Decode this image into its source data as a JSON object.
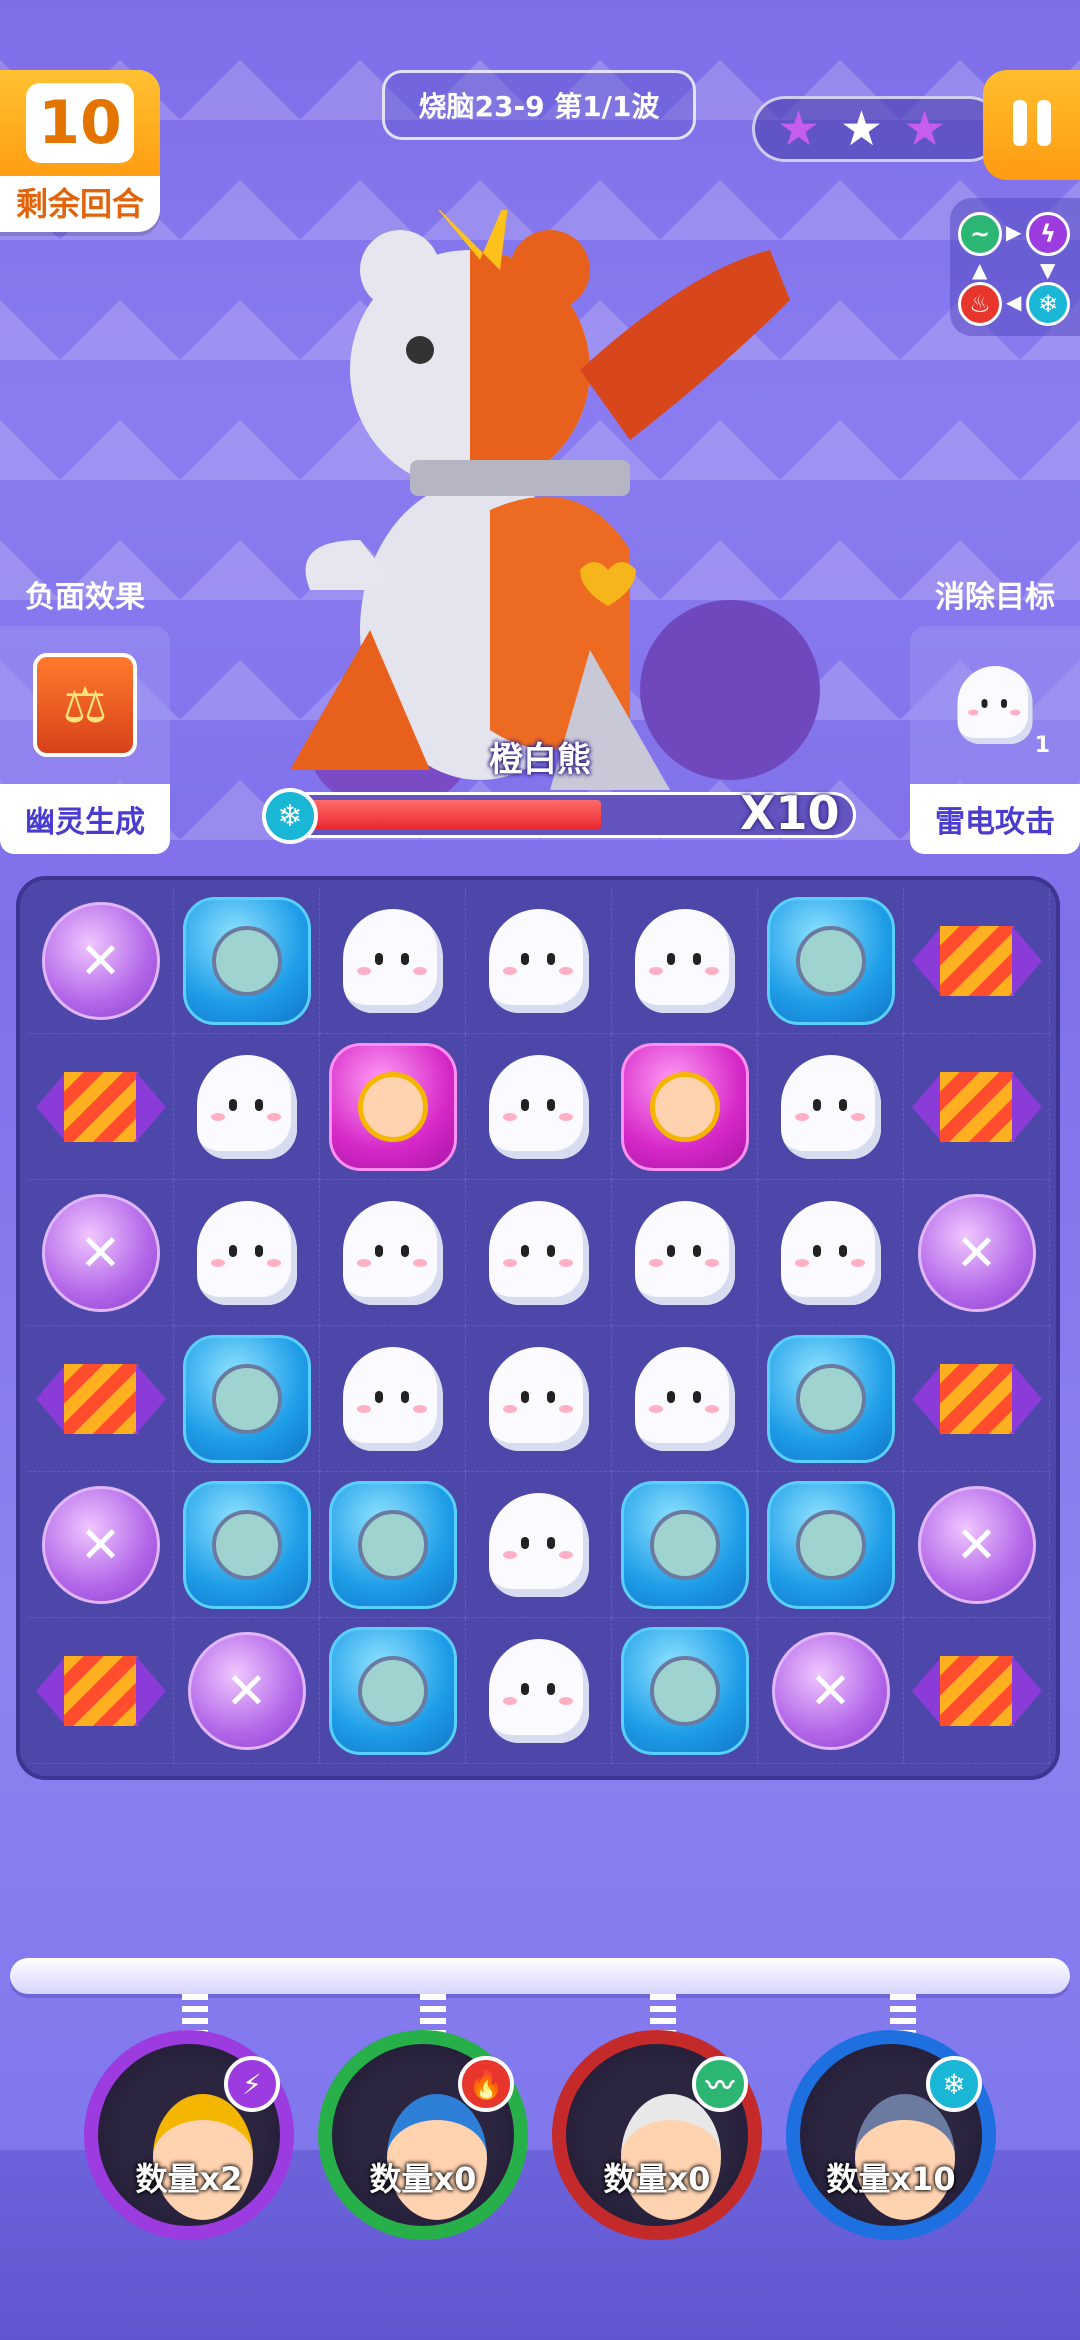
{
  "hud": {
    "turns_value": "10",
    "turns_label": "剩余回合",
    "level_text": "烧脑23-9 第1/1波",
    "stars": [
      "★",
      "★",
      "★"
    ],
    "star_colors": [
      "#c65cf0",
      "#ffffff",
      "#c65cf0"
    ],
    "pause_icon": "pause-icon"
  },
  "element_cycle": {
    "nodes": [
      "wind",
      "lightning",
      "fire",
      "ice"
    ],
    "colors": {
      "wind": "#2bb673",
      "lightning": "#9c3be0",
      "fire": "#e8362d",
      "ice": "#19b6d6"
    }
  },
  "left_panel": {
    "title": "负面效果",
    "icon": "scale-debuff-icon",
    "footer": "幽灵生成"
  },
  "right_panel": {
    "title": "消除目标",
    "target_icon": "ghost-icon",
    "target_count": "1",
    "footer": "雷电攻击"
  },
  "boss": {
    "name": "橙白熊",
    "hp_multiplier": "X10",
    "hp_fraction": 0.55
  },
  "board": {
    "rows": [
      [
        "orb",
        "blue",
        "ghost",
        "ghost",
        "ghost",
        "blue",
        "rocket"
      ],
      [
        "rocket",
        "ghost",
        "pink",
        "ghost",
        "pink",
        "ghost",
        "rocket"
      ],
      [
        "orb",
        "ghost",
        "ghost",
        "ghost",
        "ghost",
        "ghost",
        "orb"
      ],
      [
        "rocket",
        "blue",
        "ghost",
        "ghost",
        "ghost",
        "blue",
        "rocket"
      ],
      [
        "orb",
        "blue",
        "blue",
        "ghost",
        "blue",
        "blue",
        "orb"
      ],
      [
        "rocket",
        "orb",
        "blue",
        "ghost",
        "blue",
        "orb",
        "rocket"
      ]
    ]
  },
  "heroes": [
    {
      "count": "数量x2",
      "element": "lightning",
      "ring": "#9c3be0",
      "badge": "⚡"
    },
    {
      "count": "数量x0",
      "element": "fire",
      "ring": "#27b04a",
      "badge": "🔥"
    },
    {
      "count": "数量x0",
      "element": "wind",
      "ring": "#c42a2a",
      "badge": "〰"
    },
    {
      "count": "数量x10",
      "element": "ice",
      "ring": "#1e6fe0",
      "badge": "❄"
    }
  ]
}
